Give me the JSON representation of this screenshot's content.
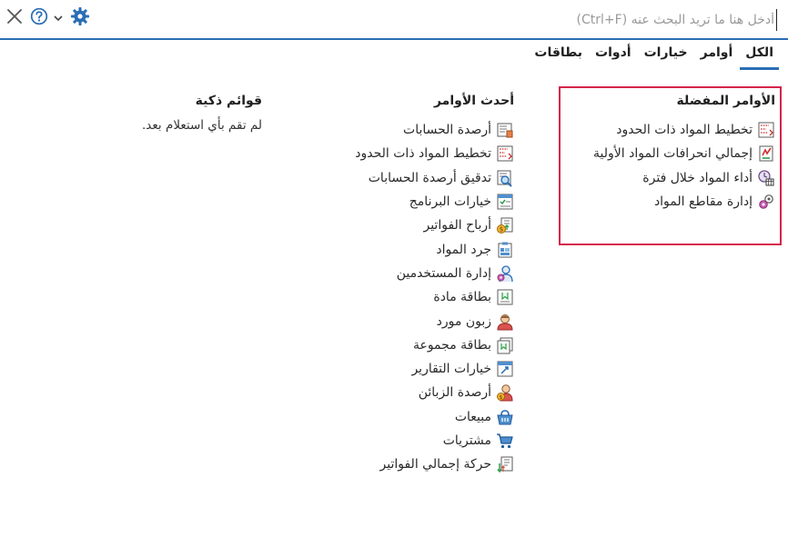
{
  "search": {
    "placeholder": "أدخل هنا ما تريد البحث عنه (Ctrl+F)"
  },
  "toolbar": {
    "close_icon": "close-icon",
    "help_icon": "help-icon",
    "chevron_icon": "chevron-down-icon",
    "settings_icon": "gear-icon"
  },
  "tabs": [
    {
      "label": "الكل",
      "active": true
    },
    {
      "label": "أوامر"
    },
    {
      "label": "خيارات"
    },
    {
      "label": "أدوات"
    },
    {
      "label": "بطاقات"
    }
  ],
  "favorites": {
    "title": "الأوامر المفضلة",
    "items": [
      {
        "label": "تخطيط المواد ذات الحدود",
        "icon": "boundary-planning-icon"
      },
      {
        "label": "إجمالي انحرافات المواد الأولية",
        "icon": "deviations-icon"
      },
      {
        "label": "أداء المواد خلال فترة",
        "icon": "period-performance-icon"
      },
      {
        "label": "إدارة مقاطع المواد",
        "icon": "segments-icon"
      }
    ]
  },
  "recent": {
    "title": "أحدث الأوامر",
    "items": [
      {
        "label": "أرصدة الحسابات",
        "icon": "account-balances-icon"
      },
      {
        "label": "تخطيط المواد ذات الحدود",
        "icon": "boundary-planning-icon"
      },
      {
        "label": "تدقيق أرصدة الحسابات",
        "icon": "audit-balances-icon"
      },
      {
        "label": "خيارات البرنامج",
        "icon": "program-options-icon"
      },
      {
        "label": "أرباح الفواتير",
        "icon": "invoice-profits-icon"
      },
      {
        "label": "جرد المواد",
        "icon": "inventory-icon"
      },
      {
        "label": "إدارة المستخدمين",
        "icon": "users-icon"
      },
      {
        "label": "بطاقة مادة",
        "icon": "material-card-icon"
      },
      {
        "label": "زبون مورد",
        "icon": "customer-supplier-icon"
      },
      {
        "label": "بطاقة مجموعة",
        "icon": "group-card-icon"
      },
      {
        "label": "خيارات التقارير",
        "icon": "report-options-icon"
      },
      {
        "label": "أرصدة الزبائن",
        "icon": "customer-balances-icon"
      },
      {
        "label": "مبيعات",
        "icon": "sales-basket-icon"
      },
      {
        "label": "مشتريات",
        "icon": "purchases-cart-icon"
      },
      {
        "label": "حركة إجمالي الفواتير",
        "icon": "invoice-movement-icon"
      }
    ]
  },
  "smart": {
    "title": "قوائم ذكية",
    "empty_text": "لم تقم بأي استعلام بعد."
  }
}
